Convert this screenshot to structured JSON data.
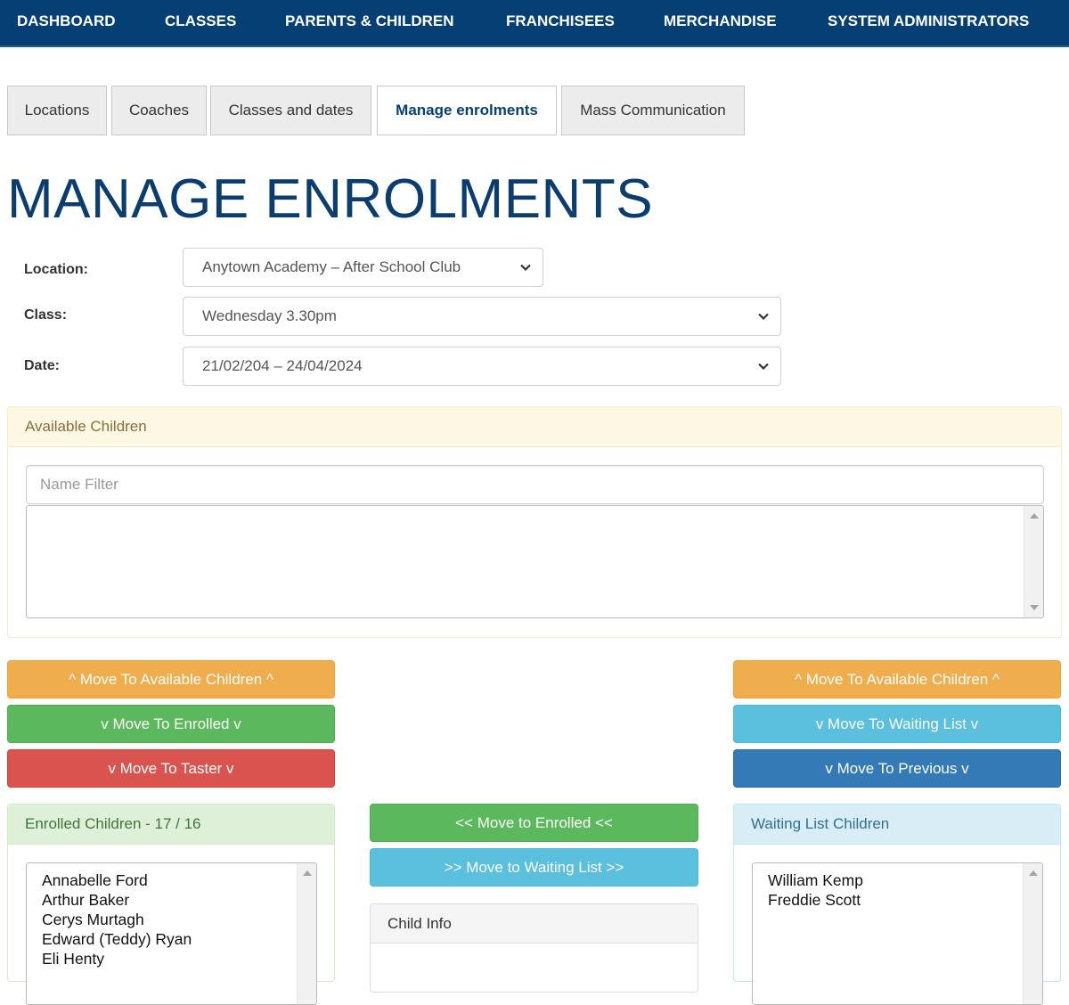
{
  "topnav": {
    "items": [
      {
        "label": "DASHBOARD"
      },
      {
        "label": "CLASSES"
      },
      {
        "label": "PARENTS & CHILDREN"
      },
      {
        "label": "FRANCHISEES"
      },
      {
        "label": "MERCHANDISE"
      },
      {
        "label": "SYSTEM ADMINISTRATORS"
      }
    ],
    "background_color": "#063f73"
  },
  "subtabs": {
    "items": [
      {
        "label": "Locations",
        "active": false
      },
      {
        "label": "Coaches",
        "active": false
      },
      {
        "label": "Classes and dates",
        "active": false
      },
      {
        "label": "Manage enrolments",
        "active": true
      },
      {
        "label": "Mass Communication",
        "active": false
      }
    ]
  },
  "page": {
    "title": "MANAGE ENROLMENTS",
    "title_color": "#0b3d6e"
  },
  "form": {
    "location": {
      "label": "Location:",
      "value": "Anytown Academy – After School Club"
    },
    "class": {
      "label": "Class:",
      "value": "Wednesday 3.30pm"
    },
    "date": {
      "label": "Date:",
      "value": "21/02/204 – 24/04/2024"
    }
  },
  "available_children": {
    "heading": "Available Children",
    "filter_placeholder": "Name Filter",
    "filter_value": "",
    "items": []
  },
  "left_actions": {
    "move_to_available": "^ Move To Available Children ^",
    "move_to_enrolled": "v Move To Enrolled v",
    "move_to_taster": "v Move To Taster v"
  },
  "right_actions": {
    "move_to_available": "^ Move To Available Children ^",
    "move_to_waiting": "v Move To Waiting List v",
    "move_to_previous": "v Move To Previous v"
  },
  "enrolled_children": {
    "heading": "Enrolled Children - 17 / 16",
    "items": [
      "Annabelle Ford",
      "Arthur Baker",
      "Cerys Murtagh",
      "Edward (Teddy) Ryan",
      "Eli Henty"
    ]
  },
  "middle_actions": {
    "move_to_enrolled": "<< Move to Enrolled <<",
    "move_to_waiting": ">> Move to Waiting List >>"
  },
  "child_info": {
    "heading": "Child Info"
  },
  "waiting_list_children": {
    "heading": "Waiting List Children",
    "items": [
      "William Kemp",
      "Freddie Scott"
    ]
  },
  "colors": {
    "warning": "#f0ad4e",
    "success": "#5cb85c",
    "danger": "#d9534f",
    "info": "#5bc0de",
    "primary": "#337ab7"
  }
}
